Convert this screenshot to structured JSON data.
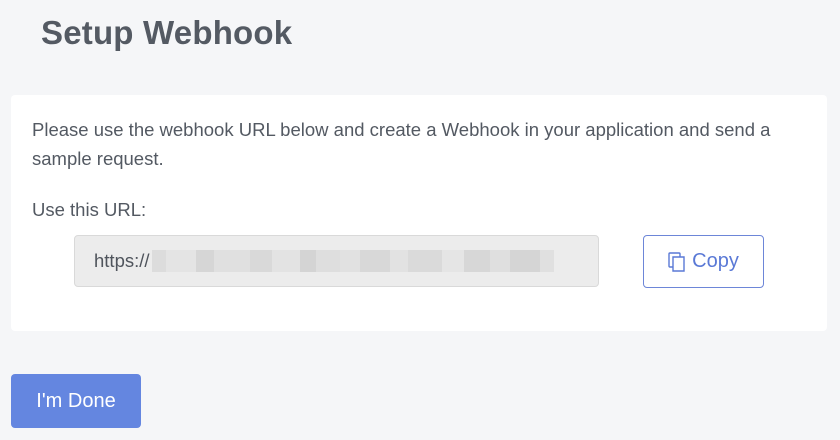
{
  "page": {
    "title": "Setup Webhook"
  },
  "card": {
    "instructions": "Please use the webhook URL below and create a Webhook in your application and send a sample request.",
    "url_label": "Use this URL:",
    "url_prefix": "https://",
    "url_redacted": true,
    "copy_label": "Copy",
    "copy_icon": "copy-icon"
  },
  "actions": {
    "done_label": "I'm Done"
  },
  "colors": {
    "background": "#f5f6f8",
    "card": "#ffffff",
    "accent": "#6486e0",
    "copy_outline": "#6d86d8"
  }
}
